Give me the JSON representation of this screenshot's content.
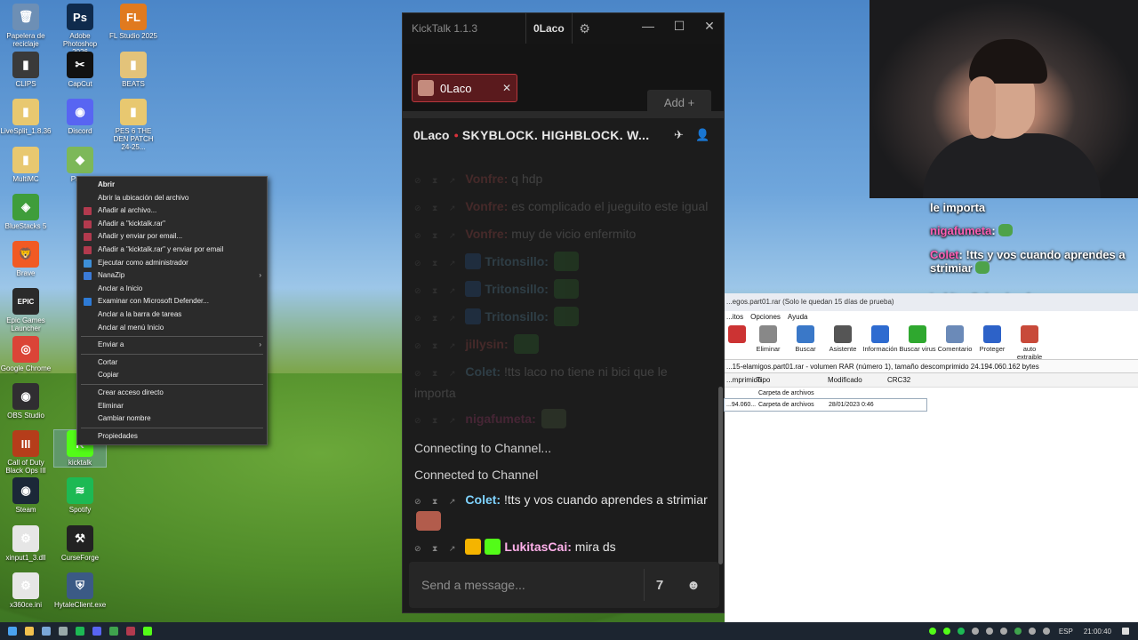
{
  "desktop": {
    "icons": [
      {
        "label": "Papelera de reciclaje",
        "glyph": "🗑",
        "color": "#6d8fb5"
      },
      {
        "label": "Adobe Photoshop 2026",
        "glyph": "Ps",
        "color": "#0f2b4d"
      },
      {
        "label": "FL Studio 2025",
        "glyph": "FL",
        "color": "#e07a1f"
      },
      {
        "label": "CLIPS",
        "glyph": "▮",
        "color": "#3a3a3a"
      },
      {
        "label": "CapCut",
        "glyph": "✂",
        "color": "#111111"
      },
      {
        "label": "BEATS",
        "glyph": "▮",
        "color": "#e3c37a"
      },
      {
        "label": "LiveSplit_1.8.36",
        "glyph": "▮",
        "color": "#e8c870"
      },
      {
        "label": "Discord",
        "glyph": "◉",
        "color": "#5865f2"
      },
      {
        "label": "PES 6 THE DEN PATCH 24-25...",
        "glyph": "▮",
        "color": "#e8c870"
      },
      {
        "label": "MultiMC",
        "glyph": "▮",
        "color": "#e8c870"
      },
      {
        "label": "Prism",
        "glyph": "◆",
        "color": "#7db859"
      },
      {
        "label": "BlueStacks 5",
        "glyph": "◈",
        "color": "#3f9d3b"
      },
      {
        "label": "Brave",
        "glyph": "🦁",
        "color": "#f15a24"
      },
      {
        "label": "Epic Games Launcher",
        "glyph": "EPIC",
        "color": "#2a2a2a"
      },
      {
        "label": "Google Chrome",
        "glyph": "◎",
        "color": "#db4437"
      },
      {
        "label": "OBS Studio",
        "glyph": "◉",
        "color": "#302e31"
      },
      {
        "label": "Call of Duty Black Ops III",
        "glyph": "III",
        "color": "#b53d1a"
      },
      {
        "label": "kicktalk",
        "glyph": "K",
        "color": "#53fc18"
      },
      {
        "label": "Steam",
        "glyph": "◉",
        "color": "#1b2838"
      },
      {
        "label": "Spotify",
        "glyph": "≋",
        "color": "#1db954"
      },
      {
        "label": "xinput1_3.dll",
        "glyph": "⚙",
        "color": "#e6e6e6"
      },
      {
        "label": "CurseForge",
        "glyph": "⚒",
        "color": "#222222"
      },
      {
        "label": "x360ce.ini",
        "glyph": "⚙",
        "color": "#e6e6e6"
      },
      {
        "label": "HytaleClient.exe",
        "glyph": "⛨",
        "color": "#3b5a85"
      }
    ]
  },
  "context_menu": {
    "items": [
      {
        "label": "Abrir",
        "bold": true,
        "icon": "",
        "sub": false
      },
      {
        "label": "Abrir la ubicación del archivo",
        "icon": "",
        "sub": false
      },
      {
        "label": "Añadir al archivo...",
        "icon": "#b23a4e",
        "sub": false
      },
      {
        "label": "Añadir a \"kicktalk.rar\"",
        "icon": "#b23a4e",
        "sub": false
      },
      {
        "label": "Añadir y enviar por email...",
        "icon": "#b23a4e",
        "sub": false
      },
      {
        "label": "Añadir a \"kicktalk.rar\" y enviar por email",
        "icon": "#b23a4e",
        "sub": false
      },
      {
        "label": "Ejecutar como administrador",
        "icon": "#3d8fd8",
        "sub": false
      },
      {
        "label": "NanaZip",
        "icon": "#3b7bd8",
        "sub": true
      },
      {
        "label": "Anclar a Inicio",
        "icon": "",
        "sub": false
      },
      {
        "label": "Examinar con Microsoft Defender...",
        "icon": "#2e7bd6",
        "sub": false
      },
      {
        "label": "Anclar a la barra de tareas",
        "icon": "",
        "sub": false
      },
      {
        "label": "Anclar al menú Inicio",
        "icon": "",
        "sub": false
      },
      {
        "sep": true
      },
      {
        "label": "Enviar a",
        "icon": "",
        "sub": true
      },
      {
        "sep": true
      },
      {
        "label": "Cortar",
        "icon": "",
        "sub": false
      },
      {
        "label": "Copiar",
        "icon": "",
        "sub": false
      },
      {
        "sep": true
      },
      {
        "label": "Crear acceso directo",
        "icon": "",
        "sub": false
      },
      {
        "label": "Eliminar",
        "icon": "",
        "sub": false
      },
      {
        "label": "Cambiar nombre",
        "icon": "",
        "sub": false
      },
      {
        "sep": true
      },
      {
        "label": "Propiedades",
        "icon": "",
        "sub": false
      }
    ]
  },
  "kicktalk": {
    "app_title": "KickTalk 1.1.3",
    "user": "0Laco",
    "tab_label": "0Laco",
    "add_label": "Add +",
    "channel": "0Laco",
    "stream_title": "SKYBLOCK. HIGHBLOCK. W...",
    "messages": [
      {
        "user": "Vonfre",
        "color": "#ff6464",
        "text": "q hdp",
        "old": true,
        "badge": ""
      },
      {
        "user": "Vonfre",
        "color": "#ff6464",
        "text": "es complicado el jueguito este igual",
        "old": true,
        "badge": ""
      },
      {
        "user": "Vonfre",
        "color": "#ff6464",
        "text": "muy de vicio enfermito",
        "old": true,
        "badge": ""
      },
      {
        "user": "Tritonsillo",
        "color": "#7fd3ff",
        "text": "",
        "old": true,
        "badge": "#2f7ad9",
        "emote": "#3ca33a"
      },
      {
        "user": "Tritonsillo",
        "color": "#7fd3ff",
        "text": "",
        "old": true,
        "badge": "#2f7ad9",
        "emote": "#3ca33a"
      },
      {
        "user": "Tritonsillo",
        "color": "#7fd3ff",
        "text": "",
        "old": true,
        "badge": "#2f7ad9",
        "emote": "#3ca33a"
      },
      {
        "user": "jillysin",
        "color": "#ff6464",
        "text": "",
        "old": true,
        "badge": "",
        "emote": "#3ca33a"
      },
      {
        "user": "Colet",
        "color": "#7fd3ff",
        "text": "!tts laco no tiene ni bici que le importa",
        "old": true,
        "badge": ""
      },
      {
        "user": "nigafumeta",
        "color": "#ff4fa3",
        "text": "",
        "old": true,
        "badge": "",
        "emote": "#6a8a55"
      }
    ],
    "system": [
      "Connecting to Channel...",
      "Connected to Channel"
    ],
    "live_messages": [
      {
        "user": "Colet",
        "color": "#7fd3ff",
        "text": "!tts y vos cuando aprendes a strimiar",
        "badge": "",
        "emote": "#b25c4c"
      },
      {
        "user": "LukitasCai",
        "color": "#ffb0ea",
        "text": "mira ds",
        "badge": "#f5b400",
        "badge2": "#53fc18"
      }
    ],
    "input_placeholder": "Send a message..."
  },
  "overlay": [
    {
      "user": "",
      "text": "le importa"
    },
    {
      "user": "nigafumeta",
      "text": ":",
      "emote": true
    },
    {
      "user": "Colet",
      "text": ": !tts y vos cuando aprendes a strimiar",
      "emote": true
    },
    {
      "user": "LukitasCai",
      "text": ": mira ds"
    }
  ],
  "winrar": {
    "title": "...egos.part01.rar (Solo le quedan 15 días de prueba)",
    "menu": [
      "...itos",
      "Opciones",
      "Ayuda"
    ],
    "tools": [
      {
        "label": "",
        "color": "#cc3333"
      },
      {
        "label": "Eliminar",
        "color": "#888888"
      },
      {
        "label": "Buscar",
        "color": "#3a78c8"
      },
      {
        "label": "Asistente",
        "color": "#555555"
      },
      {
        "label": "Información",
        "color": "#2e6bd0"
      },
      {
        "label": "Buscar virus",
        "color": "#2fa82f"
      },
      {
        "label": "Comentario",
        "color": "#6b8ab8"
      },
      {
        "label": "Proteger",
        "color": "#2d62c8"
      },
      {
        "label": "auto extraible",
        "color": "#c84a3a"
      }
    ],
    "path": "...15-elamigos.part01.rar - volumen RAR (número 1), tamaño descomprimido 24.194.060.162 bytes",
    "columns": [
      "...mprimido",
      "Tipo",
      "Modificado",
      "CRC32"
    ],
    "rows": [
      {
        "size": "",
        "type": "Carpeta de archivos",
        "date": ""
      },
      {
        "size": "...94.060...",
        "type": "Carpeta de archivos",
        "date": "28/01/2023 0:46"
      }
    ]
  },
  "taskbar": {
    "lang": "ESP",
    "time": "21:00:40"
  }
}
